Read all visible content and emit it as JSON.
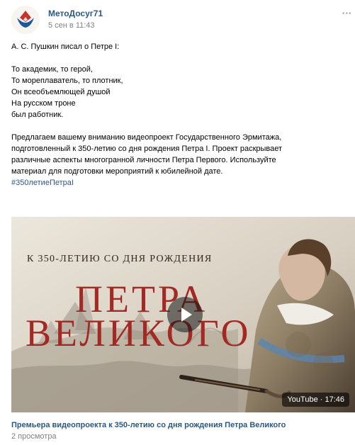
{
  "post": {
    "author": "МетоДосуг71",
    "date": "5 сен в 11:43",
    "text_intro": "А. С. Пушкин писал о Петре I:",
    "poem_lines": [
      "То академик, то герой,",
      "То мореплаватель, то плотник,",
      "Он всеобъемлющей душой",
      "На русском троне",
      "был работник."
    ],
    "description_lines": [
      "Предлагаем вашему вниманию видеопроект Государственного Эрмитажа,",
      "подготовленный к 350-летию со дня рождения Петра I. Проект раскрывает",
      "различные аспекты многогранной личности Петра Первого. Используйте",
      "материал для подготовки мероприятий к юбилейной дате."
    ],
    "hashtag": "#350летиеПетраI"
  },
  "video": {
    "overlay_subtitle": "К 350-ЛЕТИЮ СО ДНЯ РОЖДЕНИЯ",
    "overlay_title_line1": "ПЕТРА",
    "overlay_title_line2": "ВЕЛИКОГО",
    "duration": "YouTube · 17:46",
    "caption": "Премьера видеопроекта к 350-летию со дня рождения Петра Великого",
    "views": "2 просмотра"
  },
  "icons": {
    "avatar": "lotus-logo",
    "more": "more-dots-icon",
    "play": "play-icon"
  },
  "colors": {
    "link": "#2a5885",
    "muted": "#828282",
    "title_red": "#a32a24"
  }
}
